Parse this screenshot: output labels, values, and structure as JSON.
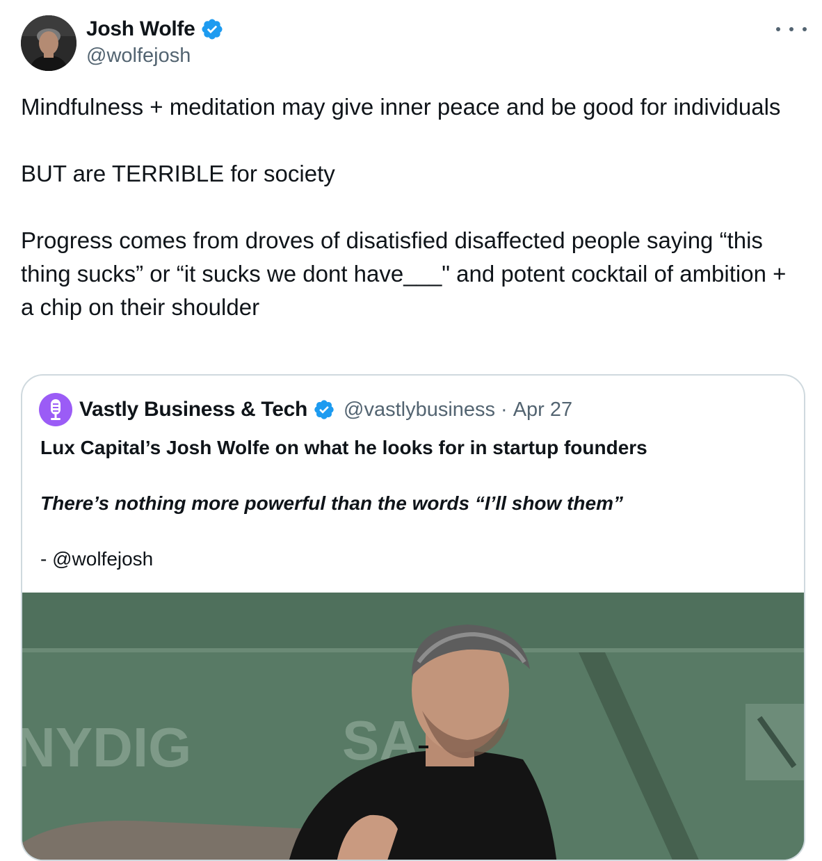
{
  "tweet": {
    "author": {
      "name": "Josh Wolfe",
      "handle": "@wolfejosh",
      "verified": true
    },
    "more_icon": "more-horizontal-icon",
    "text_paragraphs": [
      "Mindfulness + meditation may give inner peace and be good for individuals",
      "BUT are TERRIBLE for society",
      "Progress comes from droves of disatisfied disaffected people saying “this thing sucks” or “it sucks we dont have___\" and potent cocktail of ambition + a chip on their shoulder"
    ]
  },
  "quoted": {
    "author": {
      "name": "Vastly Business & Tech",
      "handle": "@vastlybusiness",
      "separator": "·",
      "date": "Apr 27",
      "verified": true
    },
    "title": "Lux Capital’s Josh Wolfe on what he looks for in startup founders",
    "quote": "There’s nothing more powerful than the words “I’ll show them”",
    "attribution": "- @wolfejosh",
    "media": {
      "background_text_left": "NYDIG",
      "background_text_mid": "SA",
      "description_icon": "video-thumbnail"
    }
  },
  "colors": {
    "text_primary": "#0f1419",
    "text_secondary": "#536471",
    "verified_blue": "#1d9bf0",
    "border": "#cfd9de",
    "quote_avatar": "#9b5cf6",
    "media_bg": "#5a7c67"
  }
}
